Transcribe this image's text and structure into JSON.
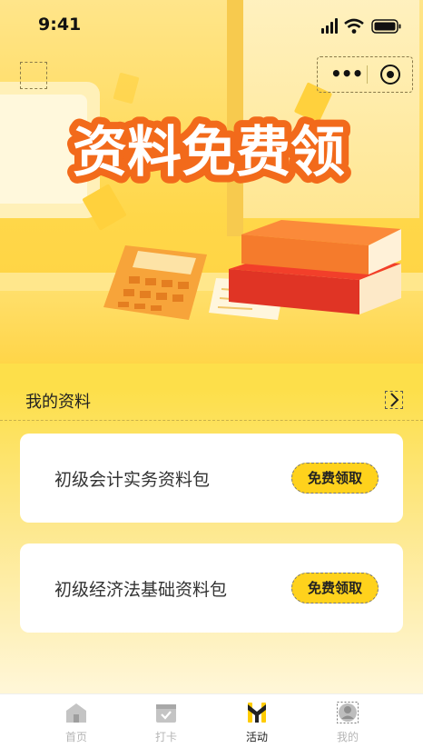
{
  "status_bar": {
    "time": "9:41"
  },
  "hero": {
    "title": "资料免费领"
  },
  "section": {
    "title": "我的资料"
  },
  "materials": [
    {
      "title": "初级会计实务资料包",
      "button": "免费领取"
    },
    {
      "title": "初级经济法基础资料包",
      "button": "免费领取"
    }
  ],
  "tabbar": [
    {
      "label": "首页",
      "icon": "home-icon",
      "active": false
    },
    {
      "label": "打卡",
      "icon": "checkin-icon",
      "active": false
    },
    {
      "label": "活动",
      "icon": "activity-icon",
      "active": true
    },
    {
      "label": "我的",
      "icon": "profile-icon",
      "active": false
    }
  ],
  "colors": {
    "accent": "#ffd21c",
    "title_orange": "#f26a1b",
    "background": "#fde24a"
  }
}
